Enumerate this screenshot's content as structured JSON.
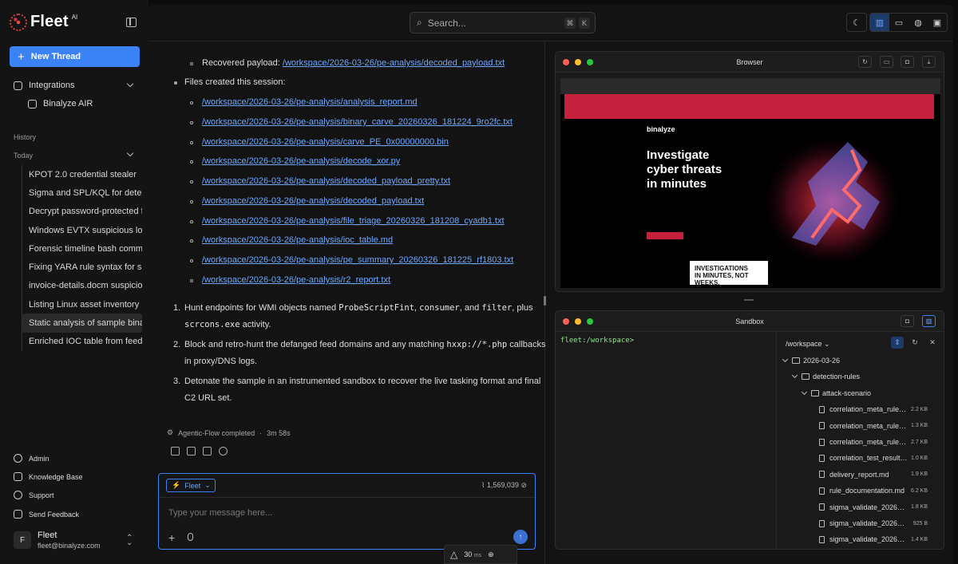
{
  "app": {
    "name": "Fleet",
    "badge": "AI"
  },
  "sidebar": {
    "new_thread": "New Thread",
    "integrations_label": "Integrations",
    "integration_item": "Binalyze AIR",
    "history_label": "History",
    "today_label": "Today",
    "history": [
      "KPOT 2.0 credential stealer",
      "Sigma and SPL/KQL for detection",
      "Decrypt password-protected files",
      "Windows EVTX suspicious logon",
      "Forensic timeline bash commands",
      "Fixing YARA rule syntax for sample",
      "invoice-details.docm suspicious macro",
      "Listing Linux asset inventory",
      "Static analysis of sample binary",
      "Enriched IOC table from feed"
    ],
    "footer": [
      "Admin",
      "Knowledge Base",
      "Support",
      "Send Feedback"
    ],
    "user": {
      "initial": "F",
      "name": "Fleet",
      "email": "fleet@binalyze.com"
    }
  },
  "topbar": {
    "search_placeholder": "Search...",
    "kbd1": "⌘",
    "kbd2": "K"
  },
  "chat": {
    "recovered_label": "Recovered payload: ",
    "recovered_link": "/workspace/2026-03-26/pe-analysis/decoded_payload.txt",
    "files_label": "Files created this session:",
    "files": [
      "/workspace/2026-03-26/pe-analysis/analysis_report.md",
      "/workspace/2026-03-26/pe-analysis/binary_carve_20260326_181224_9ro2fc.txt",
      "/workspace/2026-03-26/pe-analysis/carve_PE_0x00000000.bin",
      "/workspace/2026-03-26/pe-analysis/decode_xor.py",
      "/workspace/2026-03-26/pe-analysis/decoded_payload_pretty.txt",
      "/workspace/2026-03-26/pe-analysis/decoded_payload.txt",
      "/workspace/2026-03-26/pe-analysis/file_triage_20260326_181208_cyadb1.txt",
      "/workspace/2026-03-26/pe-analysis/ioc_table.md",
      "/workspace/2026-03-26/pe-analysis/pe_summary_20260326_181225_rf1803.txt",
      "/workspace/2026-03-26/pe-analysis/r2_report.txt"
    ],
    "steps": {
      "s1_a": "Hunt endpoints for WMI objects named ",
      "s1_c1": "ProbeScriptFint",
      "s1_b": ", ",
      "s1_c2": "consumer",
      "s1_d": ", and ",
      "s1_c3": "filter",
      "s1_e": ", plus",
      "s1_c4": "scrcons.exe",
      "s1_f": " activity.",
      "s2_a": "Block and retro-hunt the defanged feed domains and any matching ",
      "s2_c": "hxxp://*.php",
      "s2_b": " callbacks",
      "s2_line2": "in proxy/DNS logs.",
      "s3_line1": "Detonate the sample in an instrumented sandbox to recover the live tasking format and final",
      "s3_line2": "C2 URL set."
    },
    "status": "Agentic-Flow completed",
    "separator": "·",
    "duration": "3m 58s",
    "composer": {
      "agent": "Fleet",
      "tokens": "1,569,039",
      "placeholder": "Type your message here..."
    },
    "fps": {
      "value": "30",
      "unit": "ms"
    }
  },
  "browser": {
    "title": "Browser",
    "site": {
      "headline": [
        "Investigate",
        "cyber threats",
        "in minutes"
      ],
      "banner": [
        "INVESTIGATIONS",
        "IN MINUTES, NOT WEEKS."
      ],
      "brand": "binalyze"
    }
  },
  "sandbox": {
    "title": "Sandbox",
    "prompt": "fleet:/workspace>",
    "path": "/workspace",
    "tree": [
      {
        "name": "2026-03-26",
        "type": "folder",
        "level": 0,
        "size": ""
      },
      {
        "name": "detection-rules",
        "type": "folder",
        "level": 1,
        "size": ""
      },
      {
        "name": "attack-scenario",
        "type": "folder",
        "level": 2,
        "size": ""
      },
      {
        "name": "correlation_meta_rule…",
        "type": "file",
        "level": 3,
        "size": "2.2 KB"
      },
      {
        "name": "correlation_meta_rule…",
        "type": "file",
        "level": 3,
        "size": "1.3 KB"
      },
      {
        "name": "correlation_meta_rule…",
        "type": "file",
        "level": 3,
        "size": "2.7 KB"
      },
      {
        "name": "correlation_test_result…",
        "type": "file",
        "level": 3,
        "size": "1.0 KB"
      },
      {
        "name": "delivery_report.md",
        "type": "file",
        "level": 3,
        "size": "1.9 KB"
      },
      {
        "name": "rule_documentation.md",
        "type": "file",
        "level": 3,
        "size": "6.2 KB"
      },
      {
        "name": "sigma_validate_2026…",
        "type": "file",
        "level": 3,
        "size": "1.8 KB"
      },
      {
        "name": "sigma_validate_20260…",
        "type": "file",
        "level": 3,
        "size": "925 B"
      },
      {
        "name": "sigma_validate_2026…",
        "type": "file",
        "level": 3,
        "size": "1.4 KB"
      }
    ]
  },
  "colors": {
    "accent": "#3b82f6",
    "brand_red": "#c5203c",
    "terminal_green": "#8fe38f"
  }
}
